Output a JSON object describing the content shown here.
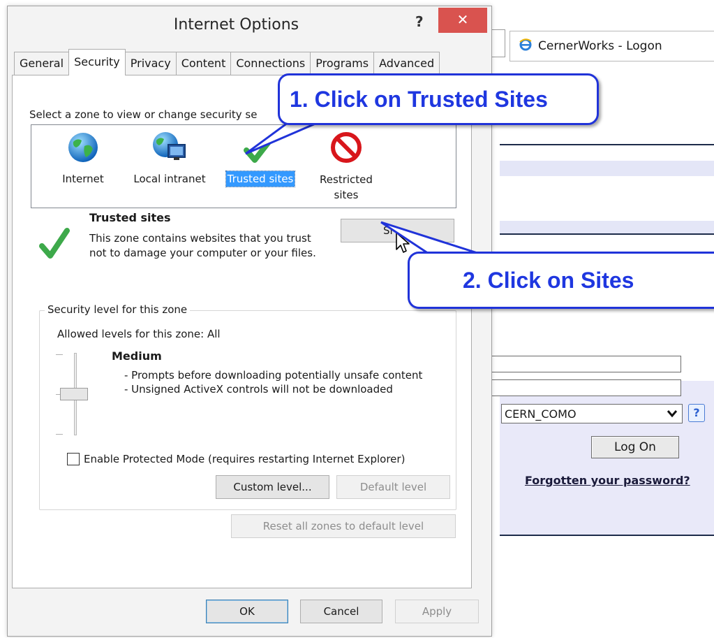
{
  "browser": {
    "tab_title": "CernerWorks - Logon",
    "domain_select_value": "CERN_COMO",
    "help_label": "?",
    "logon_label": "Log On",
    "forgot_password_label": "Forgotten your password?"
  },
  "dialog": {
    "title": "Internet Options",
    "help_label": "?",
    "close_label": "✕",
    "tabs": [
      {
        "label": "General"
      },
      {
        "label": "Security"
      },
      {
        "label": "Privacy"
      },
      {
        "label": "Content"
      },
      {
        "label": "Connections"
      },
      {
        "label": "Programs"
      },
      {
        "label": "Advanced"
      }
    ],
    "active_tab": "Security",
    "zone_prompt": "Select a zone to view or change security se",
    "zones": [
      {
        "label": "Internet",
        "icon": "globe-icon"
      },
      {
        "label": "Local intranet",
        "icon": "intranet-icon"
      },
      {
        "label": "Trusted sites",
        "icon": "green-check-icon"
      },
      {
        "label": "Restricted",
        "label2": "sites",
        "icon": "no-entry-icon"
      }
    ],
    "selected_zone": "Trusted sites",
    "zone_info": {
      "title": "Trusted sites",
      "description": "This zone contains websites that you trust not to damage your computer or your files.",
      "sites_button": "Si"
    },
    "security_level": {
      "legend": "Security level for this zone",
      "allowed": "Allowed levels for this zone: All",
      "level_name": "Medium",
      "bullets": [
        "- Prompts before downloading potentially unsafe content",
        "- Unsigned ActiveX controls will not be downloaded"
      ],
      "level_fraction": 0.5
    },
    "protected_mode_label": "Enable Protected Mode (requires restarting Internet Explorer)",
    "protected_mode_checked": false,
    "custom_level_label": "Custom level...",
    "default_level_label": "Default level",
    "reset_all_label": "Reset all zones to default level",
    "ok_label": "OK",
    "cancel_label": "Cancel",
    "apply_label": "Apply"
  },
  "callouts": [
    {
      "text": "1.  Click on Trusted Sites"
    },
    {
      "text": "2.  Click on Sites"
    }
  ],
  "colors": {
    "callout_blue": "#1f37e0",
    "close_red": "#d9534f",
    "selection_blue": "#3399ff"
  }
}
